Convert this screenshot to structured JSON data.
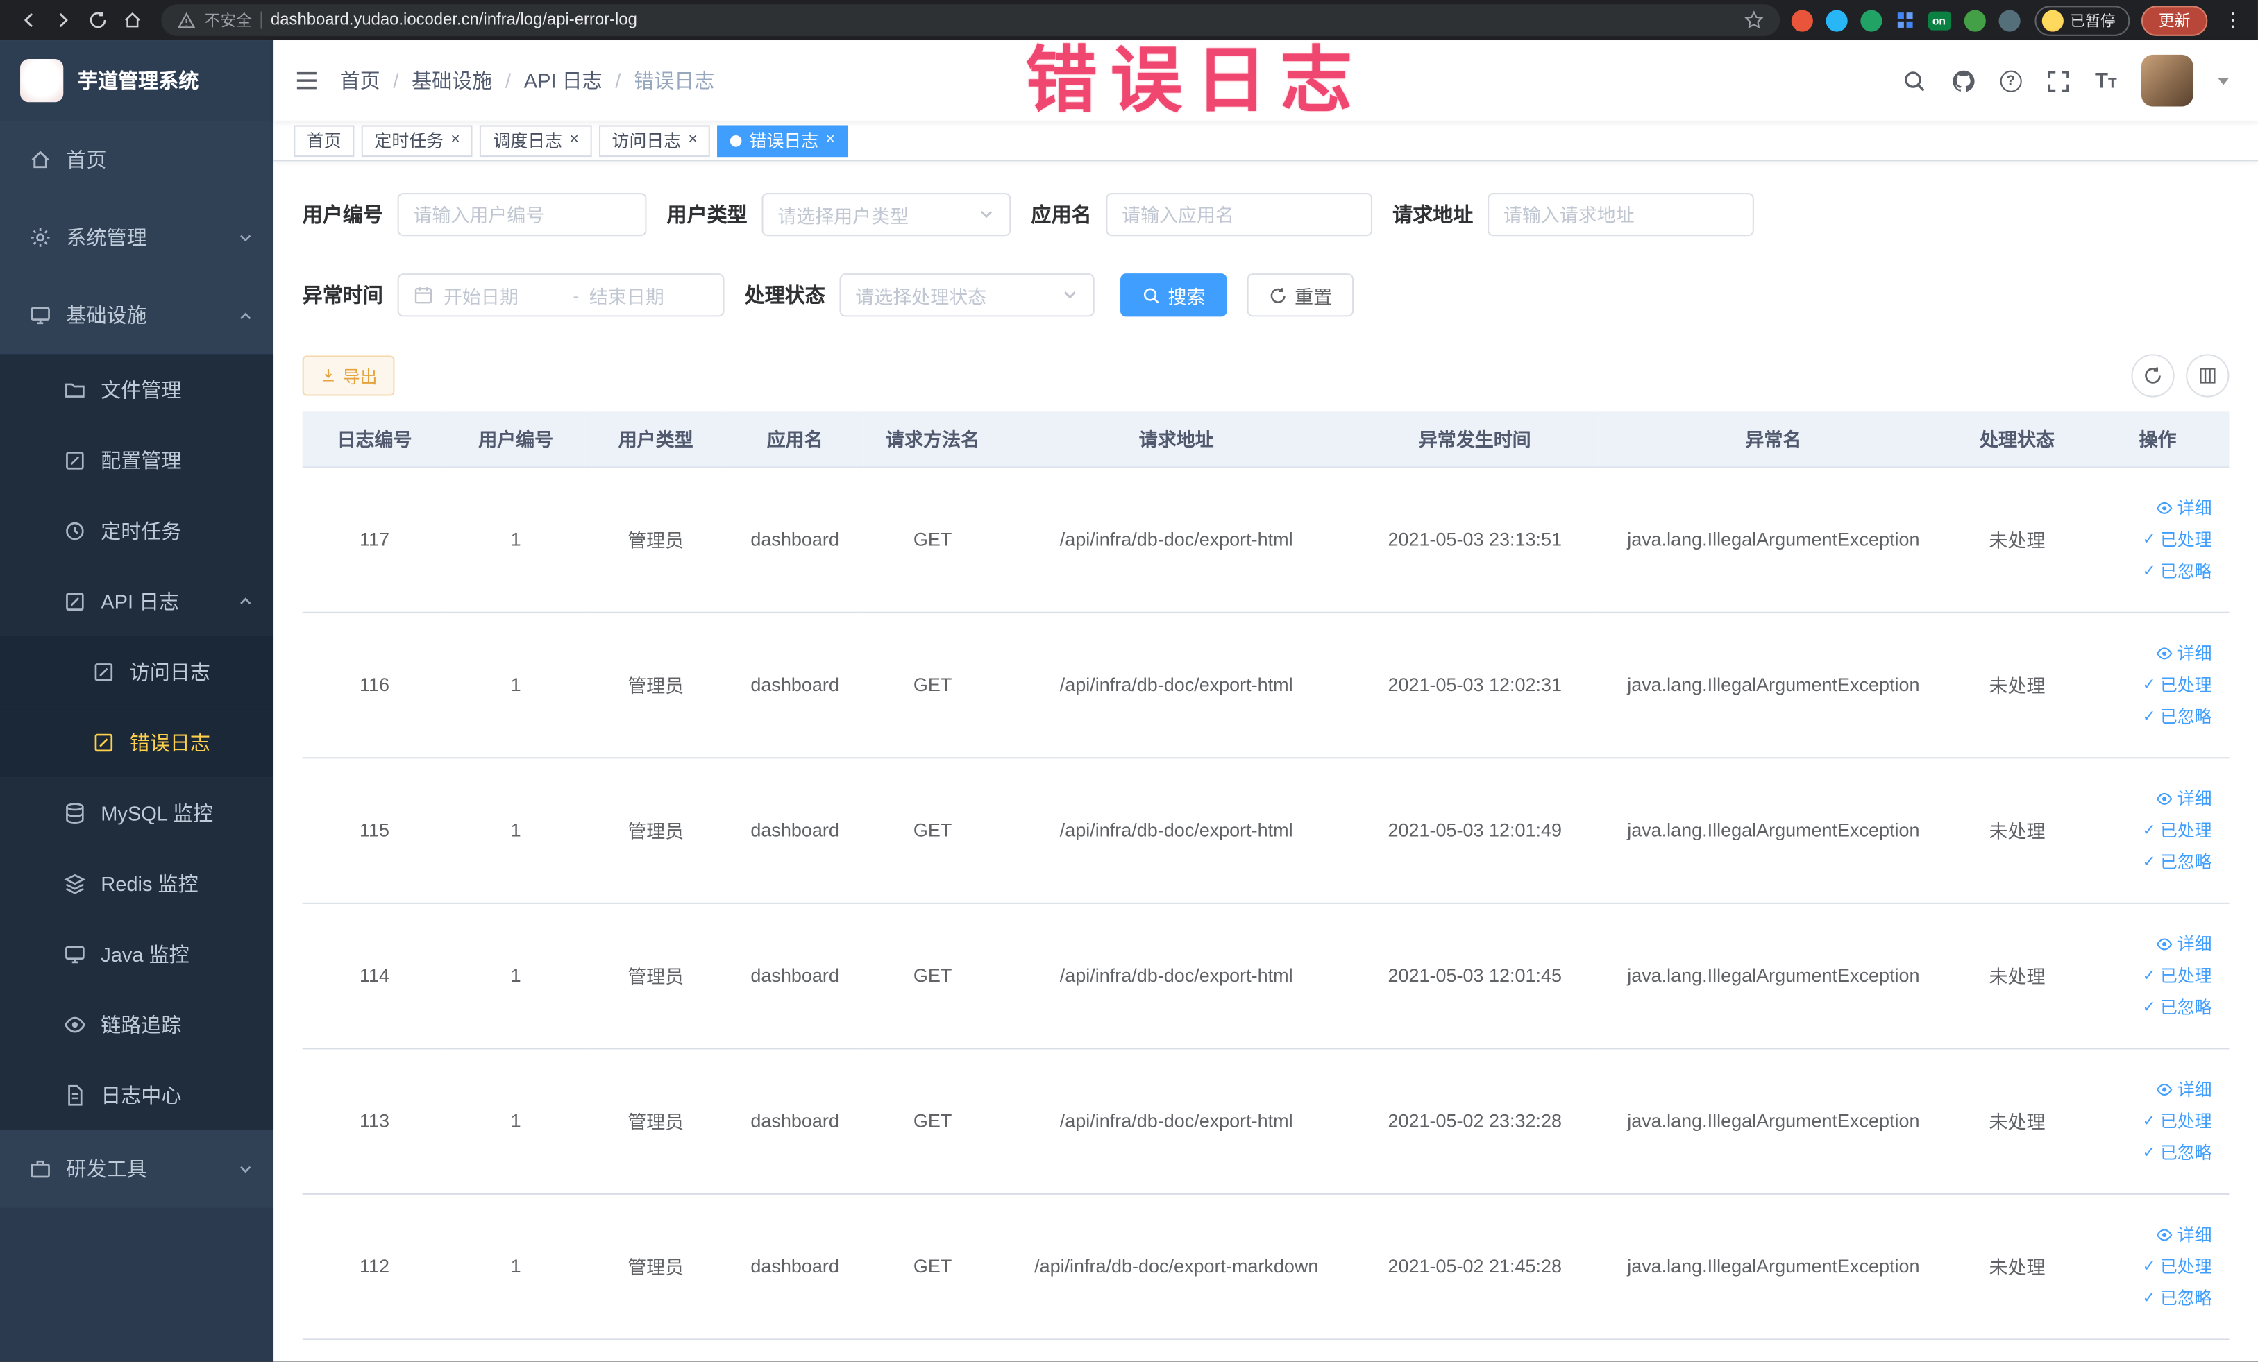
{
  "annotation": {
    "text": "错误日志"
  },
  "browser": {
    "security_label": "不安全",
    "url": "dashboard.yudao.iocoder.cn/infra/log/api-error-log",
    "extension_on_badge": "on",
    "paused_badge": "已暂停",
    "update_button": "更新"
  },
  "sidebar": {
    "logo_title": "芋道管理系统",
    "items": [
      {
        "label": "首页"
      },
      {
        "label": "系统管理"
      },
      {
        "label": "基础设施"
      },
      {
        "label": "文件管理"
      },
      {
        "label": "配置管理"
      },
      {
        "label": "定时任务"
      },
      {
        "label": "API 日志"
      },
      {
        "label": "访问日志"
      },
      {
        "label": "错误日志"
      },
      {
        "label": "MySQL 监控"
      },
      {
        "label": "Redis 监控"
      },
      {
        "label": "Java 监控"
      },
      {
        "label": "链路追踪"
      },
      {
        "label": "日志中心"
      },
      {
        "label": "研发工具"
      }
    ]
  },
  "breadcrumb": {
    "separator": "/",
    "items": [
      "首页",
      "基础设施",
      "API 日志",
      "错误日志"
    ]
  },
  "tabs": [
    {
      "label": "首页"
    },
    {
      "label": "定时任务"
    },
    {
      "label": "调度日志"
    },
    {
      "label": "访问日志"
    },
    {
      "label": "错误日志"
    }
  ],
  "filters": {
    "user_id_label": "用户编号",
    "user_id_placeholder": "请输入用户编号",
    "user_type_label": "用户类型",
    "user_type_placeholder": "请选择用户类型",
    "app_name_label": "应用名",
    "app_name_placeholder": "请输入应用名",
    "request_url_label": "请求地址",
    "request_url_placeholder": "请输入请求地址",
    "exception_time_label": "异常时间",
    "date_start_placeholder": "开始日期",
    "date_separator": "-",
    "date_end_placeholder": "结束日期",
    "process_status_label": "处理状态",
    "process_status_placeholder": "请选择处理状态",
    "search_button": "搜索",
    "reset_button": "重置"
  },
  "toolbar": {
    "export_button": "导出"
  },
  "table": {
    "columns": [
      "日志编号",
      "用户编号",
      "用户类型",
      "应用名",
      "请求方法名",
      "请求地址",
      "异常发生时间",
      "异常名",
      "处理状态",
      "操作"
    ],
    "row_actions": {
      "detail": "详细",
      "processed": "已处理",
      "ignored": "已忽略"
    },
    "rows": [
      {
        "log_id": "117",
        "user_id": "1",
        "user_type": "管理员",
        "app_name": "dashboard",
        "method": "GET",
        "url": "/api/infra/db-doc/export-html",
        "time": "2021-05-03 23:13:51",
        "exception": "java.lang.IllegalArgumentException",
        "status": "未处理"
      },
      {
        "log_id": "116",
        "user_id": "1",
        "user_type": "管理员",
        "app_name": "dashboard",
        "method": "GET",
        "url": "/api/infra/db-doc/export-html",
        "time": "2021-05-03 12:02:31",
        "exception": "java.lang.IllegalArgumentException",
        "status": "未处理"
      },
      {
        "log_id": "115",
        "user_id": "1",
        "user_type": "管理员",
        "app_name": "dashboard",
        "method": "GET",
        "url": "/api/infra/db-doc/export-html",
        "time": "2021-05-03 12:01:49",
        "exception": "java.lang.IllegalArgumentException",
        "status": "未处理"
      },
      {
        "log_id": "114",
        "user_id": "1",
        "user_type": "管理员",
        "app_name": "dashboard",
        "method": "GET",
        "url": "/api/infra/db-doc/export-html",
        "time": "2021-05-03 12:01:45",
        "exception": "java.lang.IllegalArgumentException",
        "status": "未处理"
      },
      {
        "log_id": "113",
        "user_id": "1",
        "user_type": "管理员",
        "app_name": "dashboard",
        "method": "GET",
        "url": "/api/infra/db-doc/export-html",
        "time": "2021-05-02 23:32:28",
        "exception": "java.lang.IllegalArgumentException",
        "status": "未处理"
      },
      {
        "log_id": "112",
        "user_id": "1",
        "user_type": "管理员",
        "app_name": "dashboard",
        "method": "GET",
        "url": "/api/infra/db-doc/export-markdown",
        "time": "2021-05-02 21:45:28",
        "exception": "java.lang.IllegalArgumentException",
        "status": "未处理"
      }
    ]
  }
}
